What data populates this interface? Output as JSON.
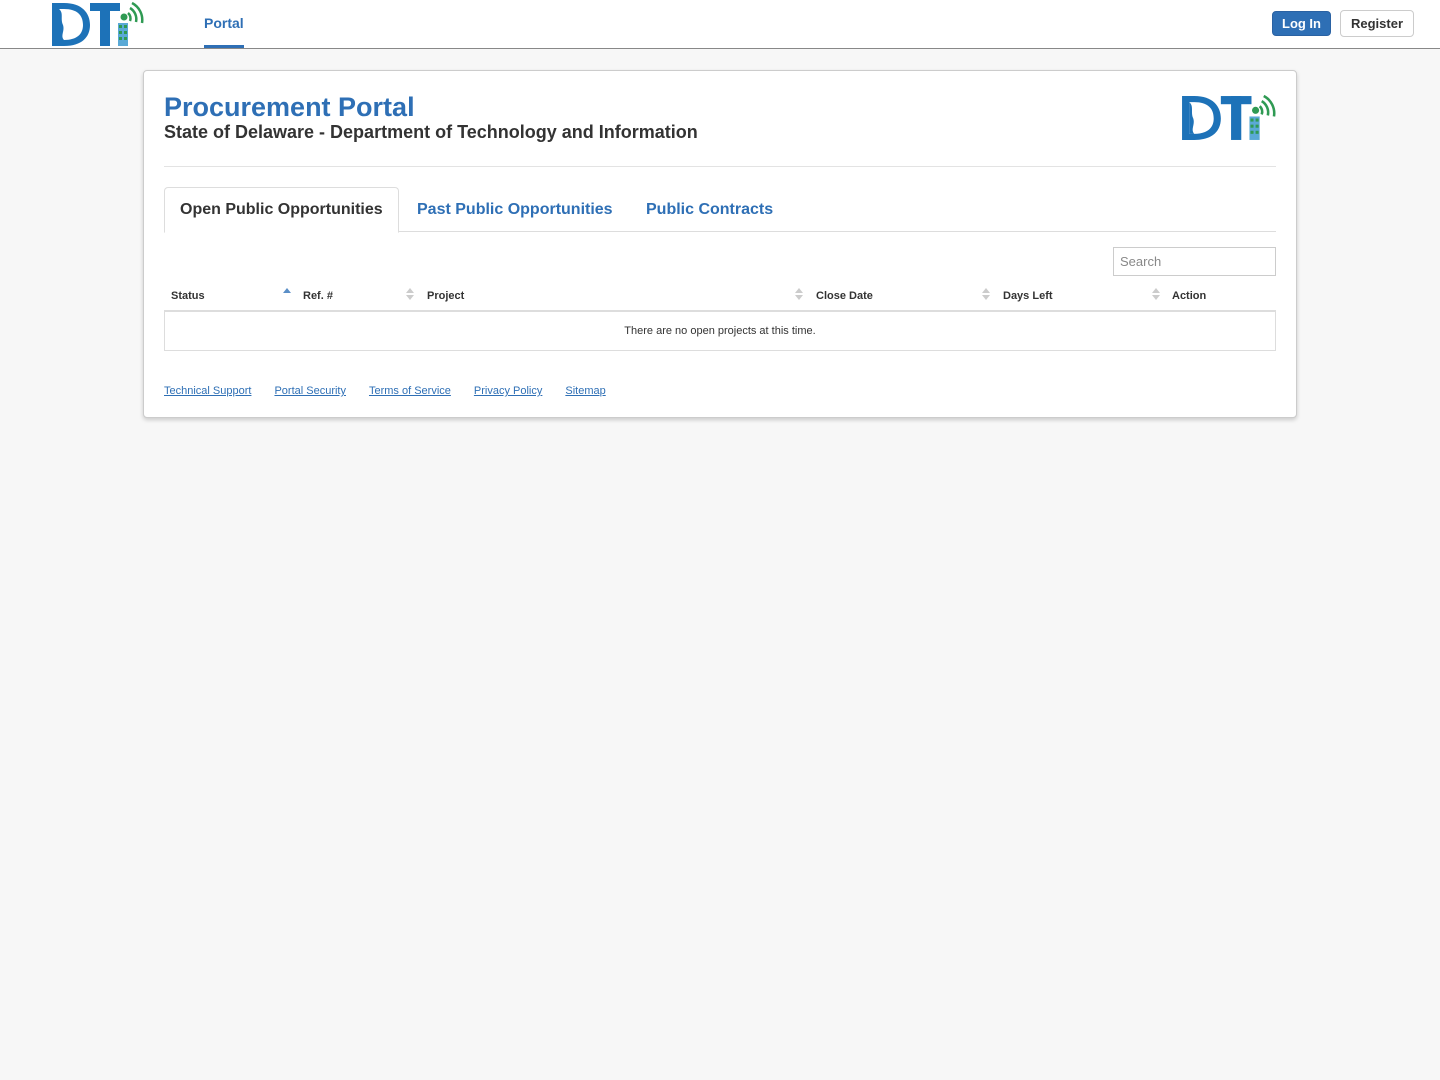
{
  "navbar": {
    "logo_icon": "dti-logo",
    "portal_link": "Portal",
    "login_button": "Log In",
    "register_button": "Register"
  },
  "card": {
    "title": "Procurement Portal",
    "subtitle": "State of Delaware - Department of Technology and Information",
    "logo_icon": "dti-logo"
  },
  "tabs": [
    {
      "label": "Open Public Opportunities",
      "active": true
    },
    {
      "label": "Past Public Opportunities",
      "active": false
    },
    {
      "label": "Public Contracts",
      "active": false
    }
  ],
  "search": {
    "placeholder": "Search",
    "value": ""
  },
  "table": {
    "columns": [
      "Status",
      "Ref. #",
      "Project",
      "Close Date",
      "Days Left",
      "Action"
    ],
    "sorted_column": "Status",
    "sort_direction": "ascending",
    "empty_message": "There are no open projects at this time."
  },
  "footer": {
    "links": [
      "Technical Support",
      "Portal Security",
      "Terms of Service",
      "Privacy Policy",
      "Sitemap"
    ]
  },
  "colors": {
    "brand_blue": "#2e6fb5",
    "logo_green": "#2f9a53",
    "page_background": "#f7f7f7"
  }
}
